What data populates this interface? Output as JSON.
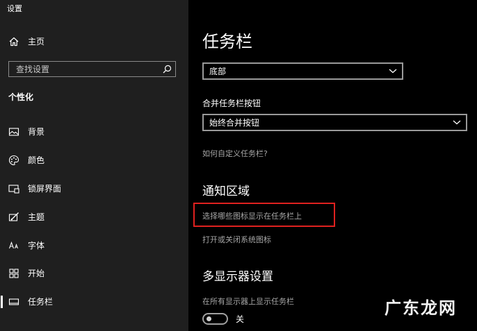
{
  "window": {
    "title": "设置"
  },
  "sidebar": {
    "home_label": "主页",
    "search_placeholder": "查找设置",
    "section_heading": "个性化",
    "items": [
      {
        "label": "背景",
        "icon": "picture-icon",
        "selected": false
      },
      {
        "label": "颜色",
        "icon": "palette-icon",
        "selected": false
      },
      {
        "label": "锁屏界面",
        "icon": "lock-screen-icon",
        "selected": false
      },
      {
        "label": "主题",
        "icon": "theme-brush-icon",
        "selected": false
      },
      {
        "label": "字体",
        "icon": "font-icon",
        "selected": false
      },
      {
        "label": "开始",
        "icon": "start-icon",
        "selected": false
      },
      {
        "label": "任务栏",
        "icon": "taskbar-icon",
        "selected": true
      }
    ]
  },
  "main": {
    "title": "任务栏",
    "position_select": {
      "value": "底部"
    },
    "combine_label": "合并任务栏按钮",
    "combine_select": {
      "value": "始终合并按钮"
    },
    "customize_link": "如何自定义任务栏?",
    "notification_title": "通知区域",
    "select_icons_link": "选择哪些图标显示在任务栏上",
    "system_icons_link": "打开或关闭系统图标",
    "multi_display_title": "多显示器设置",
    "multi_display_label": "在所有显示器上显示任务栏",
    "multi_display_toggle": {
      "state": "关",
      "on": false
    }
  },
  "overlay": {
    "highlight_color": "#e0211f",
    "watermark": "广东龙网"
  },
  "colors": {
    "sidebar_bg": "#1f1f1f",
    "main_bg": "#000000",
    "link_gray": "#a6a6a6"
  }
}
